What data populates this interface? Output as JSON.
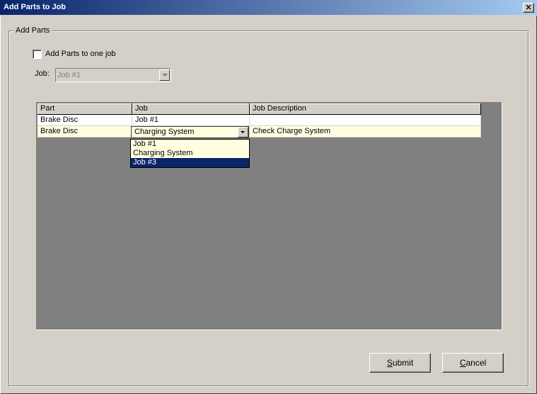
{
  "window": {
    "title": "Add Parts to Job",
    "close_label": "×"
  },
  "group": {
    "label": "Add Parts"
  },
  "options": {
    "checkbox_label": "Add Parts to one job",
    "checked": false
  },
  "job_field": {
    "label": "Job:",
    "value": "Job #1"
  },
  "grid": {
    "columns": [
      "Part",
      "Job",
      "Job Description"
    ],
    "rows": [
      {
        "part": "Brake Disc",
        "job": "Job #1",
        "description": ""
      },
      {
        "part": "Brake Disc",
        "job": "Charging System",
        "description": "Check Charge System"
      }
    ]
  },
  "dropdown": {
    "selected_value": "Charging System",
    "options": [
      "Job #1",
      "Charging System",
      "Job #3"
    ],
    "highlighted": "Job #3"
  },
  "buttons": {
    "submit_mnemonic": "S",
    "submit_rest": "ubmit",
    "cancel_mnemonic": "C",
    "cancel_rest": "ancel"
  },
  "colors": {
    "title_gradient_start": "#0a246a",
    "selection": "#0a246a",
    "grid_bg": "#808080",
    "edit_row": "#ffffe0"
  }
}
